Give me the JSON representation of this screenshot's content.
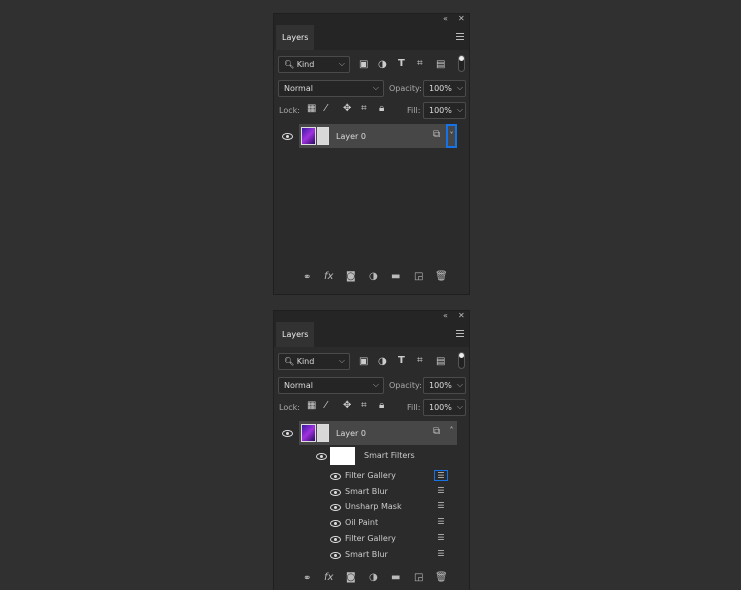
{
  "panels": [
    {
      "tab": "Layers",
      "kind": "Kind",
      "blend": "Normal",
      "opacity_label": "Opacity:",
      "opacity": "100%",
      "lock_label": "Lock:",
      "fill_label": "Fill:",
      "fill": "100%",
      "layer_name": "Layer 0",
      "expanded": false
    },
    {
      "tab": "Layers",
      "kind": "Kind",
      "blend": "Normal",
      "opacity_label": "Opacity:",
      "opacity": "100%",
      "lock_label": "Lock:",
      "fill_label": "Fill:",
      "fill": "100%",
      "layer_name": "Layer 0",
      "expanded": true,
      "smart_filters_label": "Smart Filters",
      "filters": [
        "Filter Gallery",
        "Smart Blur",
        "Unsharp Mask",
        "Oil Paint",
        "Filter Gallery",
        "Smart Blur"
      ]
    }
  ],
  "colors": {
    "accent": "#1473e6",
    "selected_row": "#474747"
  }
}
